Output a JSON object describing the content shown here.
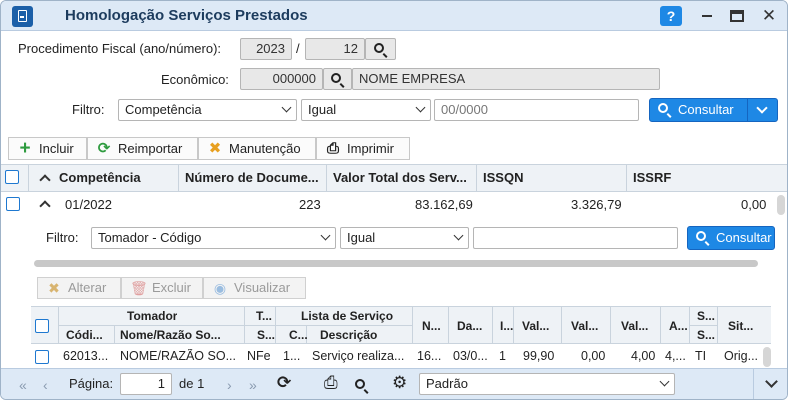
{
  "window": {
    "title": "Homologação Serviços Prestados",
    "help_label": "?",
    "close_label": "✕"
  },
  "form": {
    "procedimento_label": "Procedimento Fiscal (ano/número):",
    "ano_value": "2023",
    "separator": "/",
    "numero_value": "12",
    "economico_label": "Econômico:",
    "economico_value": "000000",
    "empresa_value": "NOME EMPRESA",
    "filtro_label": "Filtro:",
    "filtro_field": "Competência",
    "filtro_operator": "Igual",
    "filtro_value_placeholder": "00/0000",
    "consultar_label": "Consultar"
  },
  "toolbar": {
    "incluir": "Incluir",
    "reimportar": "Reimportar",
    "manutencao": "Manutenção",
    "imprimir": "Imprimir"
  },
  "grid": {
    "columns": [
      "Competência",
      "Número de Docume...",
      "Valor Total dos Serv...",
      "ISSQN",
      "ISSRF"
    ],
    "rows": [
      {
        "competencia": "01/2022",
        "numero": "223",
        "valor_total": "83.162,69",
        "issqn": "3.326,79",
        "issrf": "0,00"
      }
    ]
  },
  "detail": {
    "filtro_label": "Filtro:",
    "filtro_field": "Tomador - Código",
    "filtro_operator": "Igual",
    "consultar_label": "Consultar",
    "alterar": "Alterar",
    "excluir": "Excluir",
    "visualizar": "Visualizar",
    "group_tomador": "Tomador",
    "group_t": "T...",
    "group_lista": "Lista de Serviço",
    "columns": {
      "codigo": "Códi...",
      "nome": "Nome/Razão So...",
      "s": "S...",
      "c": "C...",
      "descricao": "Descrição",
      "n": "N...",
      "da": "Da...",
      "i": "I...",
      "val1": "Val...",
      "val2": "Val...",
      "val3": "Val...",
      "a": "A...",
      "s2top": "S...",
      "s2bottom": "S...",
      "sit": "Sit..."
    },
    "row": {
      "codigo": "62013...",
      "nome": "NOME/RAZÃO SO...",
      "s": "NFe",
      "c": "1...",
      "descricao": "Serviço realiza...",
      "n": "16...",
      "da": "03/0...",
      "i": "1",
      "val1": "99,90",
      "val2": "0,00",
      "val3": "4,00",
      "a": "4,...",
      "s2": "TI",
      "sit": "Orig..."
    }
  },
  "pager": {
    "pagina_label": "Página:",
    "page_value": "1",
    "de_label": "de 1",
    "layout_value": "Padrão"
  }
}
